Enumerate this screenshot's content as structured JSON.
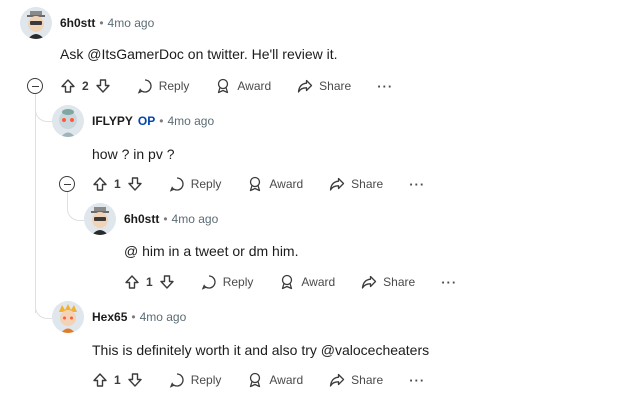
{
  "comments": [
    {
      "author": "6h0stt",
      "op_label": "",
      "time": "4mo ago",
      "text": "Ask @ItsGamerDoc on twitter. He'll review it.",
      "score": "2",
      "reply_label": "Reply",
      "award_label": "Award",
      "share_label": "Share",
      "more_label": "···"
    },
    {
      "author": "IFLYPY",
      "op_label": "OP",
      "time": "4mo ago",
      "text": "how ? in pv ?",
      "score": "1",
      "reply_label": "Reply",
      "award_label": "Award",
      "share_label": "Share",
      "more_label": "···"
    },
    {
      "author": "6h0stt",
      "op_label": "",
      "time": "4mo ago",
      "text": "@ him in a tweet or dm him.",
      "score": "1",
      "reply_label": "Reply",
      "award_label": "Award",
      "share_label": "Share",
      "more_label": "···"
    },
    {
      "author": "Hex65",
      "op_label": "",
      "time": "4mo ago",
      "text": "This is definitely worth it and also try @valocecheaters",
      "score": "1",
      "reply_label": "Reply",
      "award_label": "Award",
      "share_label": "Share",
      "more_label": "···"
    }
  ],
  "separator": "•",
  "colors": {
    "op": "#0045ac",
    "thread_line": "#e0e0e0",
    "meta": "#5c6c74"
  }
}
